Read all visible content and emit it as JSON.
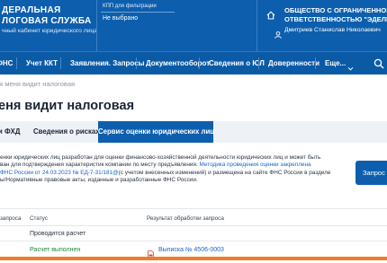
{
  "header": {
    "org_line1": "ДЕРАЛЬНАЯ",
    "org_line2": "ЛОГОВАЯ СЛУЖБА",
    "org_subtitle": "чный кабинет юридического лица",
    "kpp_label": "КПП для фильтрации",
    "kpp_value": "Не выбрано",
    "company_line1": "ОБЩЕСТВО С ОГРАНИЧЕННОЙ",
    "company_line2": "ОТВЕТСТВЕННОСТЬЮ \"ЭДЕЛЬВЕЙ",
    "user_name": "Дмитриев Станислав Николаевич"
  },
  "nav": {
    "items": [
      "ФНС",
      "Учет ККТ",
      "Заявления. Запросы",
      "Документооборот",
      "Сведения о ЮЛ",
      "Доверенности",
      "Еще..."
    ]
  },
  "breadcrumb": "к меня видит налоговая",
  "page_title": "еня видит налоговая",
  "tabs": [
    "и ФХД",
    "Сведения о рисках",
    "Сервис оценки юридических лиц"
  ],
  "description": {
    "line1": "енки юридических лиц разработан для оценки финансово-хозяйственной деятельности юридических лиц и может быть",
    "line2a": "ван для подтверждения характеристик компании по месту предъявления. ",
    "line2b": "Методика проведения оценки закреплена",
    "line3a": "ФНС России от 24.03.2023 № ЕД-7-31/181@",
    "line3b": "(с учетом внесенных изменений) и размещена на сайте ФНС России в разделе",
    "line4": "ы/Нормативные правовые акты, изданные и разработанные ФНС России."
  },
  "request_button": "Запрос",
  "table": {
    "headers": [
      "запроса",
      "Статус",
      "Результат обработки запроса"
    ],
    "rows": [
      {
        "status": "Проводится расчет",
        "result": ""
      },
      {
        "status": "Расчет выполнен",
        "result": "Выписка № 4506-0003"
      }
    ]
  },
  "colors": {
    "brand_blue": "#0d5fae",
    "success_green": "#1e8a3a",
    "link_blue": "#1a66c2",
    "accent_orange": "#f07b2a"
  },
  "icons": {
    "search": "search-icon",
    "user": "user-icon",
    "home": "home-icon",
    "document": "pdf-document-icon"
  }
}
